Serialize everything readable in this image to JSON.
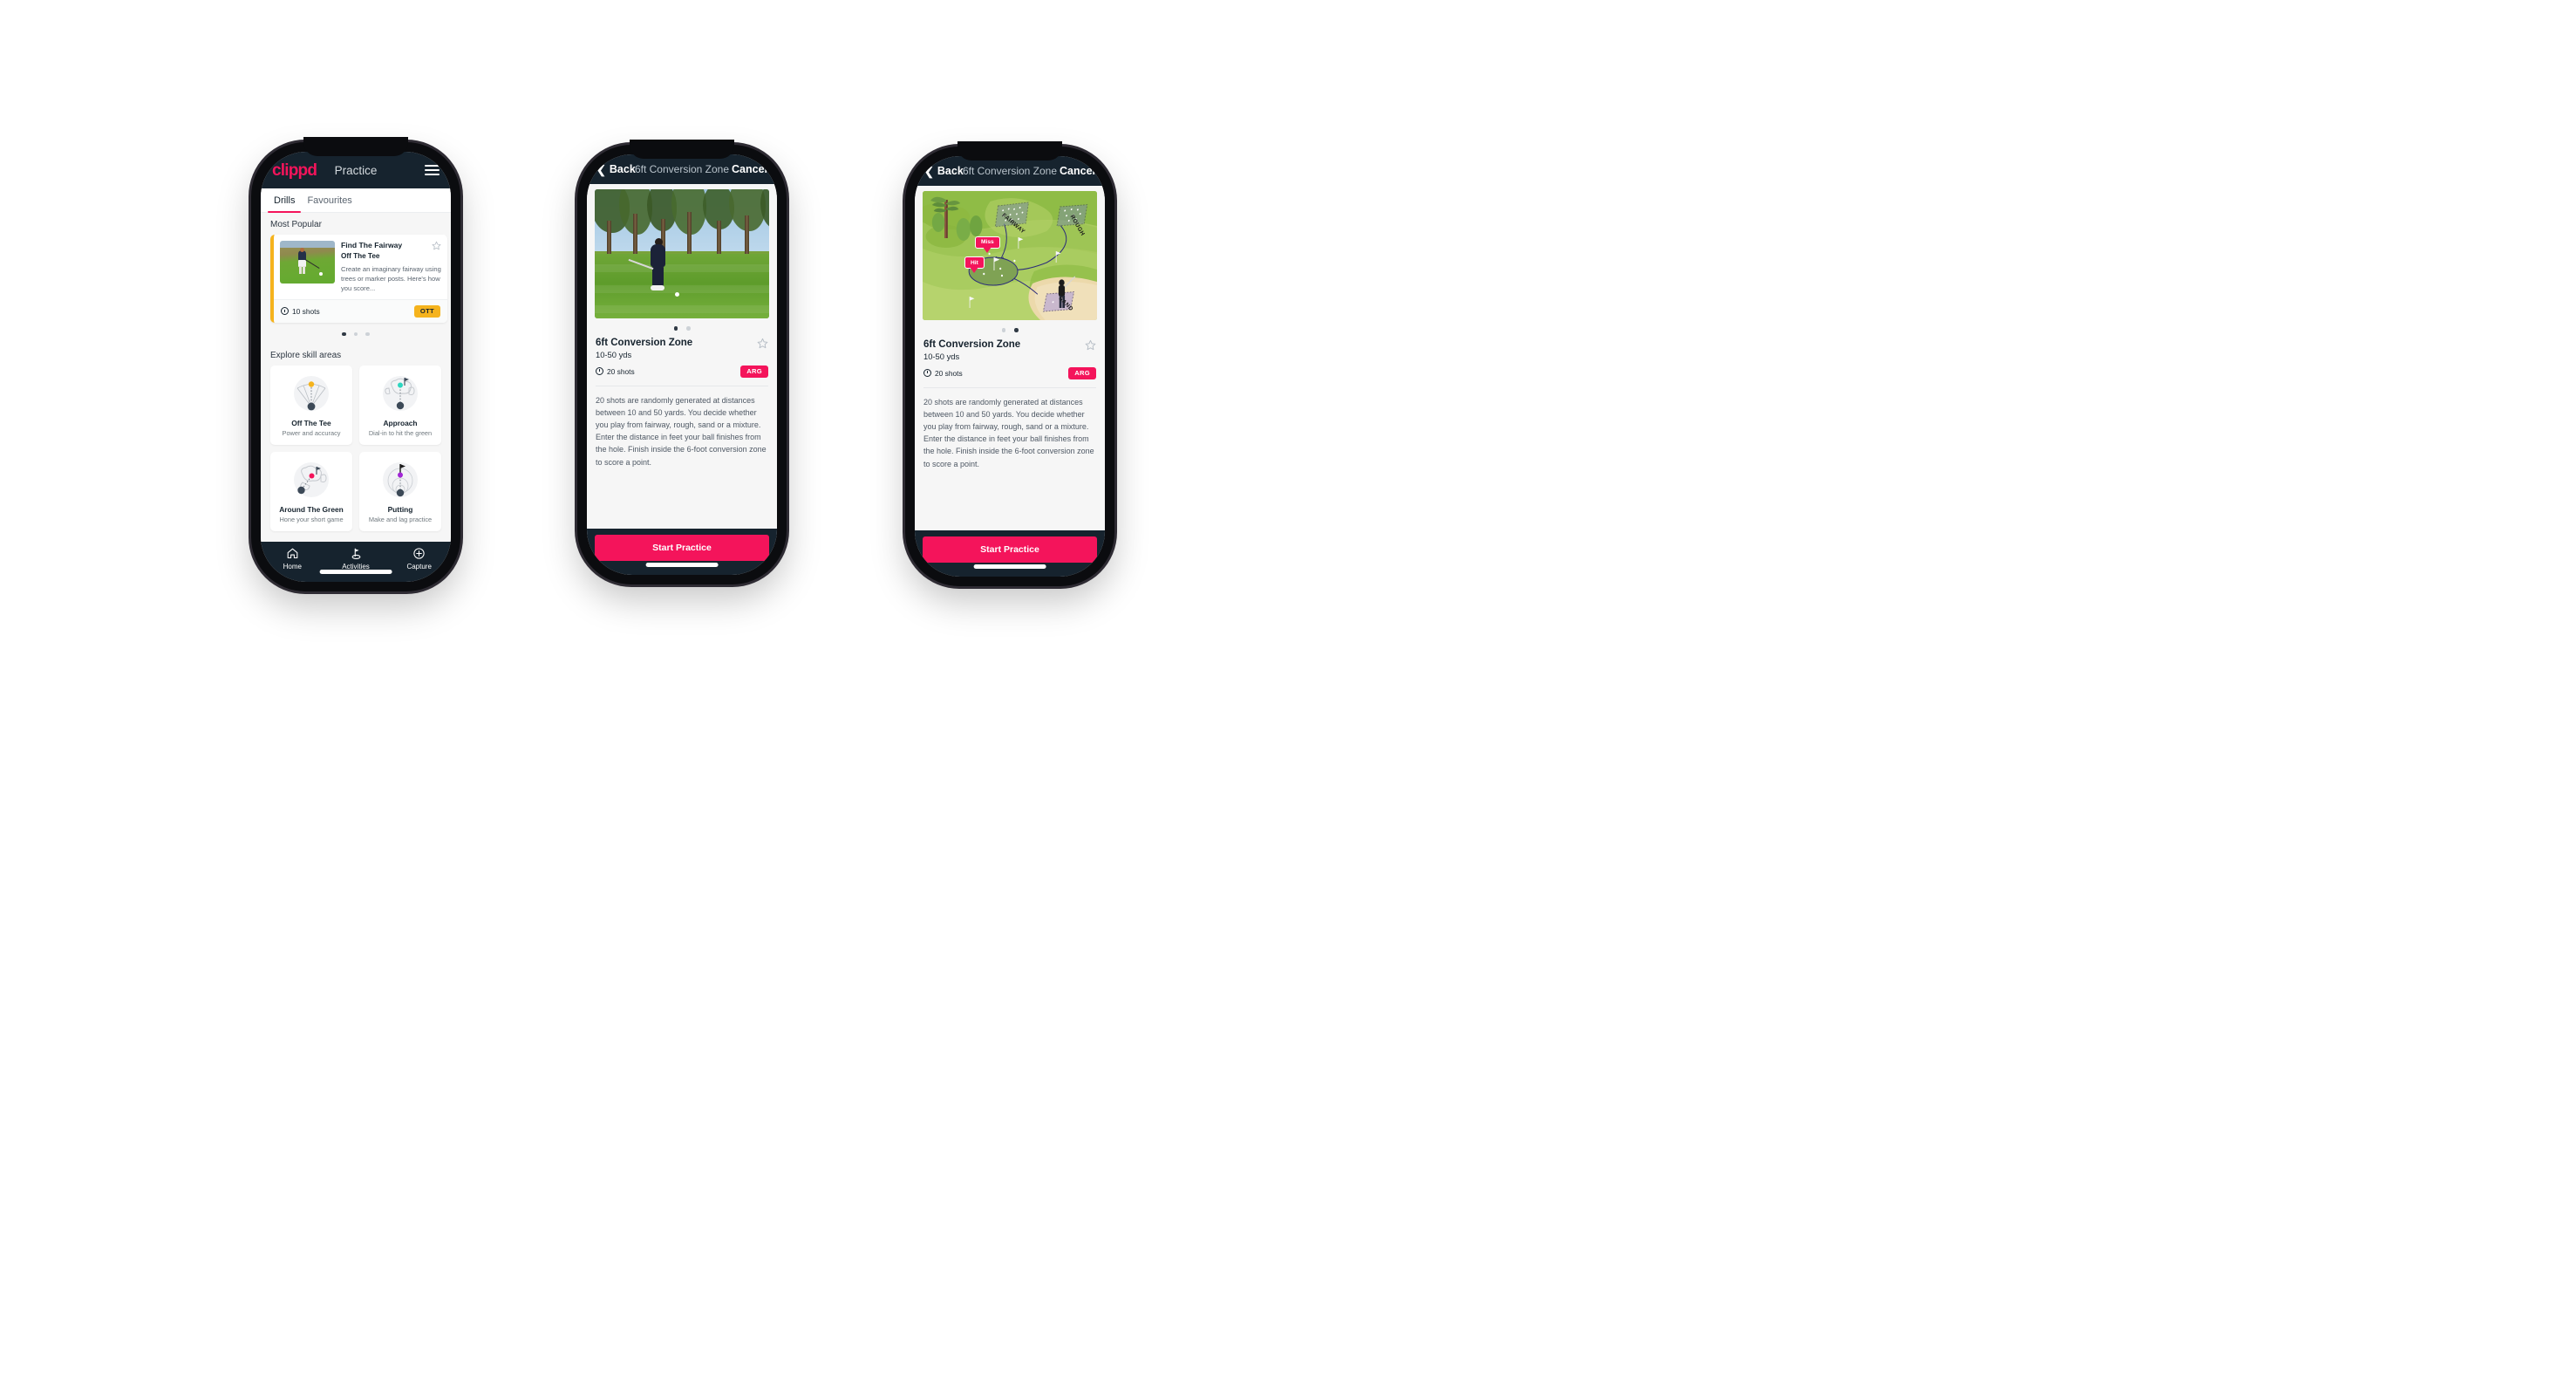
{
  "practice_screen": {
    "appbar": {
      "logo": "clippd",
      "title": "Practice",
      "menu_icon": "hamburger-menu-icon"
    },
    "tabs": [
      {
        "label": "Drills",
        "active": true
      },
      {
        "label": "Favourites",
        "active": false
      }
    ],
    "most_popular": {
      "section_label": "Most Popular",
      "card": {
        "title": "Find The Fairway",
        "subtitle": "Off The Tee",
        "description": "Create an imaginary fairway using trees or marker posts. Here's how you score...",
        "shots": "10 shots",
        "badge": "OTT",
        "badge_color": "#f5b31d",
        "accent_color": "#f5b31d",
        "star_icon": "star-outline-icon",
        "clock_icon": "clock-icon",
        "thumbnail": "golfer-teeing-off-photo"
      },
      "peek_card_accent": "#2ed6c0",
      "dots": {
        "count": 3,
        "active": 0
      }
    },
    "explore": {
      "section_label": "Explore skill areas",
      "cards": [
        {
          "name": "Off The Tee",
          "desc": "Power and accuracy",
          "icon": "tee-dispersion-icon",
          "accent": "#f5b31d"
        },
        {
          "name": "Approach",
          "desc": "Dial-in to hit the green",
          "icon": "approach-green-icon",
          "accent": "#2ed6c0"
        },
        {
          "name": "Around The Green",
          "desc": "Hone your short game",
          "icon": "around-green-icon",
          "accent": "#f4145b"
        },
        {
          "name": "Putting",
          "desc": "Make and lag practice",
          "icon": "putting-rings-icon",
          "accent": "#a226d6"
        }
      ]
    },
    "tabbar": [
      {
        "label": "Home",
        "icon": "home-icon",
        "active": false
      },
      {
        "label": "Activities",
        "icon": "golf-flag-icon",
        "active": true
      },
      {
        "label": "Capture",
        "icon": "plus-circle-icon",
        "active": false
      }
    ]
  },
  "drill_detail": {
    "navbar": {
      "back": "Back",
      "title": "6ft Conversion Zone",
      "cancel": "Cancel",
      "back_icon": "chevron-left-icon"
    },
    "title": "6ft Conversion Zone",
    "yardage": "10-50 yds",
    "shots": "20 shots",
    "badge": "ARG",
    "badge_color": "#f4145b",
    "star_icon": "star-outline-icon",
    "description": "20 shots are randomly generated at distances between 10 and 50 yards. You decide whether you play from fairway, rough, sand or a mixture. Enter the distance in feet your ball finishes from the hole. Finish inside the 6-foot conversion zone to score a point.",
    "cta": "Start Practice",
    "media": {
      "video": {
        "kind": "golfer-chipping-photo",
        "dots": {
          "count": 2,
          "active": 0
        }
      },
      "map": {
        "kind": "golf-hole-diagram",
        "dots": {
          "count": 2,
          "active": 1
        },
        "zone_labels": [
          "FAIRWAY",
          "ROUGH",
          "SAND"
        ],
        "markers": [
          "Miss",
          "Hit"
        ],
        "marker_color": "#f4145b"
      }
    }
  }
}
